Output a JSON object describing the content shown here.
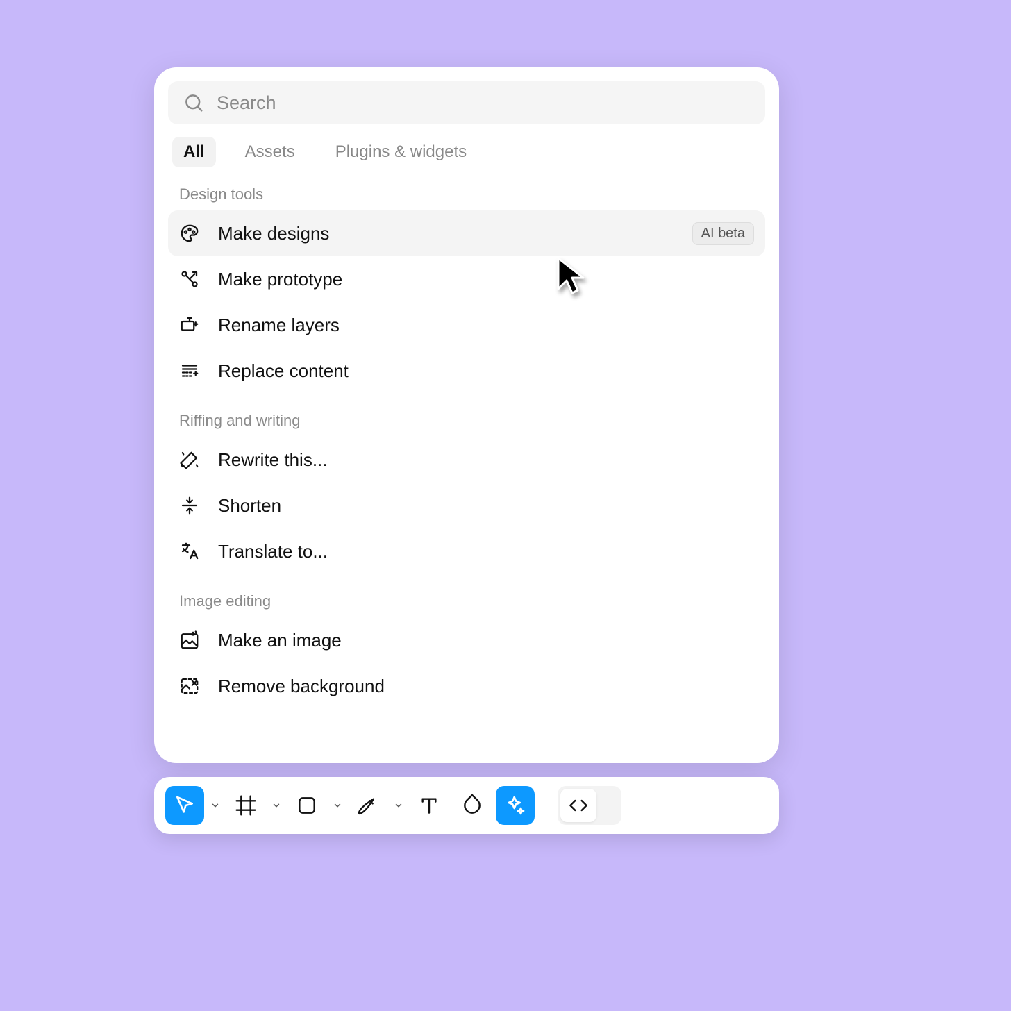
{
  "search": {
    "placeholder": "Search"
  },
  "tabs": [
    {
      "label": "All",
      "active": true
    },
    {
      "label": "Assets",
      "active": false
    },
    {
      "label": "Plugins & widgets",
      "active": false
    }
  ],
  "sections": [
    {
      "label": "Design tools",
      "items": [
        {
          "icon": "palette",
          "label": "Make designs",
          "badge": "AI beta",
          "hover": true
        },
        {
          "icon": "prototype",
          "label": "Make prototype"
        },
        {
          "icon": "rename",
          "label": "Rename layers"
        },
        {
          "icon": "replace",
          "label": "Replace content"
        }
      ]
    },
    {
      "label": "Riffing and writing",
      "items": [
        {
          "icon": "rewrite",
          "label": "Rewrite this..."
        },
        {
          "icon": "shorten",
          "label": "Shorten"
        },
        {
          "icon": "translate",
          "label": "Translate to..."
        }
      ]
    },
    {
      "label": "Image editing",
      "items": [
        {
          "icon": "makeimage",
          "label": "Make an image"
        },
        {
          "icon": "removebg",
          "label": "Remove background"
        }
      ]
    }
  ],
  "toolbar": {
    "move_active": true,
    "ai_active": true
  }
}
